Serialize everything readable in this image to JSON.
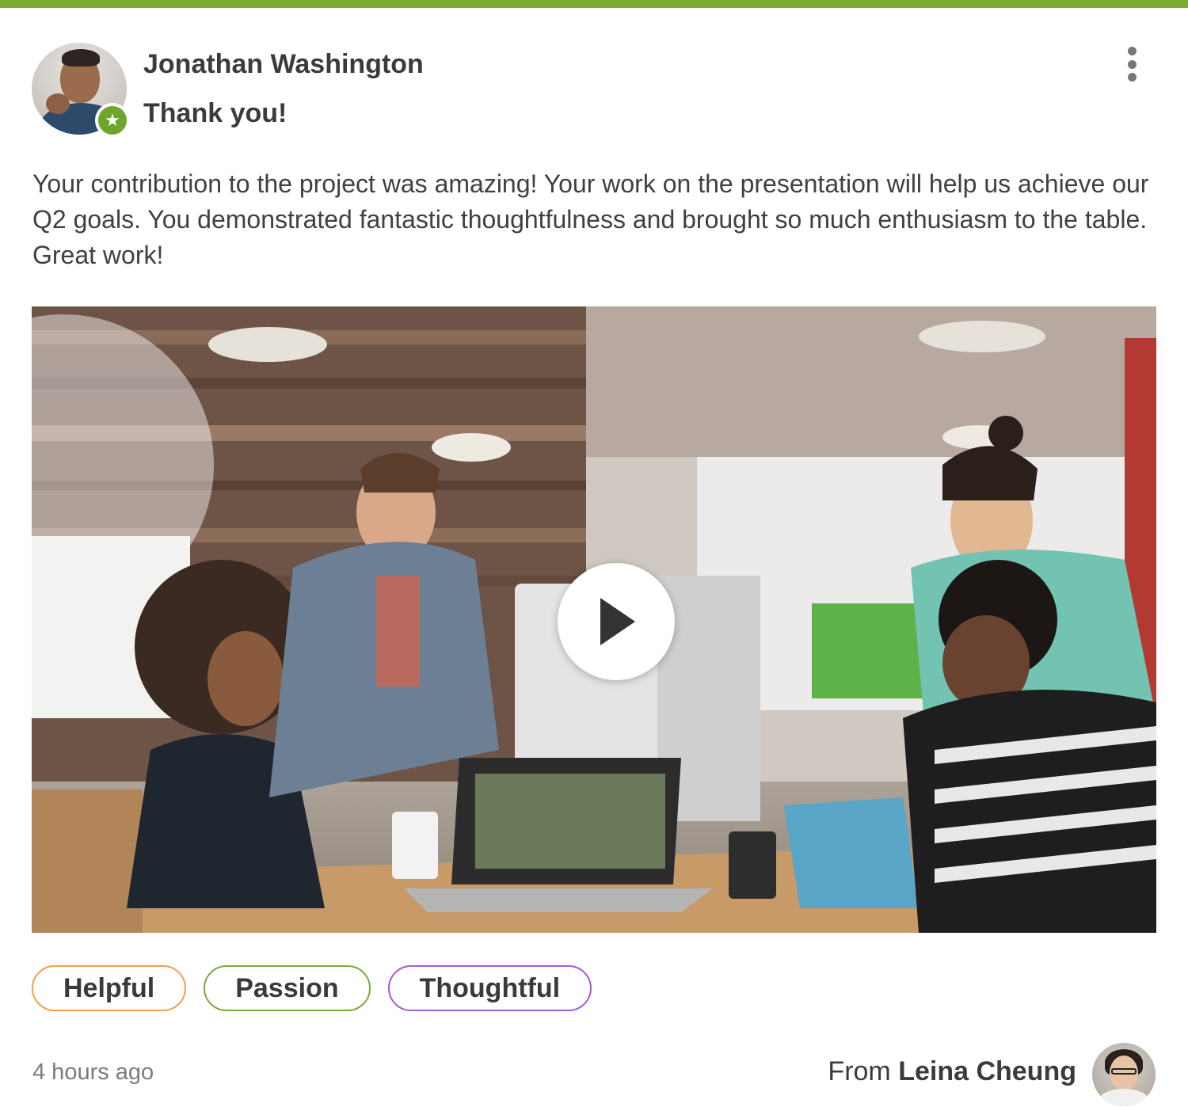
{
  "post": {
    "recipient_name": "Jonathan Washington",
    "title": "Thank you!",
    "message": "Your contribution to the project was amazing! Your work on the presentation will help us achieve our Q2 goals. You demonstrated fantastic thoughtfulness and brought so much enthusiasm to the table. Great work!",
    "badge_icon": "star-icon",
    "menu_icon": "more-vertical-icon"
  },
  "media": {
    "type": "video",
    "play_icon": "play-icon"
  },
  "tags": [
    {
      "label": "Helpful",
      "color": "#f0a04b"
    },
    {
      "label": "Passion",
      "color": "#7aaa3a"
    },
    {
      "label": "Thoughtful",
      "color": "#a55bd6"
    }
  ],
  "footer": {
    "timestamp": "4 hours ago",
    "from_prefix": "From",
    "sender_name": "Leina Cheung"
  },
  "colors": {
    "accent": "#7aaa2f",
    "badge": "#6da52d"
  }
}
